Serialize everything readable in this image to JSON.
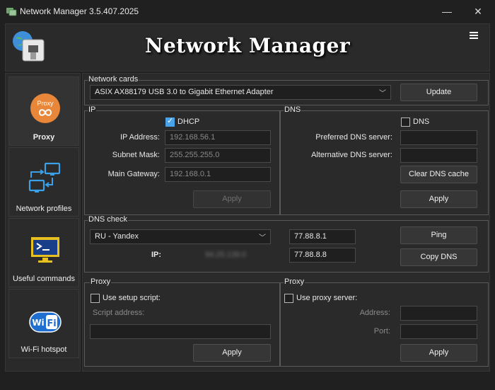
{
  "window": {
    "title": "Network Manager 3.5.407.2025",
    "icon": "network-manager-app-icon",
    "controls": {
      "minimize": "—",
      "close": "✕"
    }
  },
  "header": {
    "title": "Network Manager",
    "menu_icon": "hamburger-menu-icon"
  },
  "sidebar": {
    "items": [
      {
        "label": "Proxy",
        "icon": "proxy-icon",
        "icon_text": "Proxy",
        "active": true
      },
      {
        "label": "Network profiles",
        "icon": "network-profiles-icon",
        "active": false
      },
      {
        "label": "Useful commands",
        "icon": "terminal-icon",
        "active": false
      },
      {
        "label": "Wi-Fi hotspot",
        "icon": "wifi-icon",
        "icon_text": "Wi Fi",
        "active": false
      }
    ]
  },
  "network_cards": {
    "group_label": "Network cards",
    "selected": "ASIX AX88179 USB 3.0 to Gigabit Ethernet Adapter",
    "update_label": "Update"
  },
  "ip": {
    "group_label": "IP",
    "dhcp_label": "DHCP",
    "dhcp_checked": true,
    "ip_label": "IP Address:",
    "ip_value": "192.168.56.1",
    "mask_label": "Subnet Mask:",
    "mask_value": "255.255.255.0",
    "gateway_label": "Main Gateway:",
    "gateway_value": "192.168.0.1",
    "apply_label": "Apply"
  },
  "dns": {
    "group_label": "DNS",
    "dns_label": "DNS",
    "dns_checked": false,
    "preferred_label": "Preferred DNS server:",
    "preferred_value": "",
    "alternative_label": "Alternative DNS server:",
    "alternative_value": "",
    "clear_label": "Clear DNS cache",
    "apply_label": "Apply"
  },
  "dns_check": {
    "group_label": "DNS check",
    "provider": "RU - Yandex",
    "dns1": "77.88.8.1",
    "ip_label": "IP:",
    "ip_value": "94.25.139.0",
    "dns2": "77.88.8.8",
    "ping_label": "Ping",
    "copy_label": "Copy DNS"
  },
  "proxy_left": {
    "group_label": "Proxy",
    "setup_label": "Use setup script:",
    "setup_checked": false,
    "script_label": "Script address:",
    "script_value": "",
    "apply_label": "Apply"
  },
  "proxy_right": {
    "group_label": "Proxy",
    "server_label": "Use proxy server:",
    "server_checked": false,
    "address_label": "Address:",
    "address_value": "",
    "port_label": "Port:",
    "port_value": "",
    "apply_label": "Apply"
  }
}
